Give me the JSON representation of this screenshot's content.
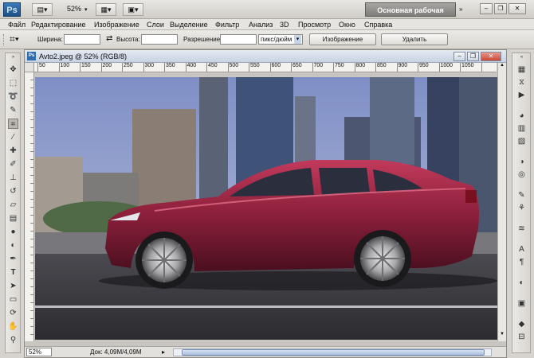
{
  "app": {
    "logo": "Ps",
    "zoom_display": "52%",
    "workspace_button": "Основная рабочая среда"
  },
  "menu": [
    "Файл",
    "Редактирование",
    "Изображение",
    "Слои",
    "Выделение",
    "Фильтр",
    "Анализ",
    "3D",
    "Просмотр",
    "Окно",
    "Справка"
  ],
  "options": {
    "width_label": "Ширина:",
    "height_label": "Высота:",
    "resolution_label": "Разрешение:",
    "unit_select": "пикс/дюйм",
    "image_button": "Изображение",
    "delete_button": "Удалить",
    "swap_icon": "⇄"
  },
  "document": {
    "title": "Avto2.jpeg @ 52% (RGB/8)",
    "icon_label": "Ps",
    "ruler_ticks": [
      "50",
      "100",
      "150",
      "200",
      "250",
      "300",
      "350",
      "400",
      "450",
      "500",
      "550",
      "600",
      "650",
      "700",
      "750",
      "800",
      "850",
      "900",
      "950",
      "1000",
      "1050"
    ]
  },
  "status": {
    "zoom": "52%",
    "doc_info": "Док: 4,09M/4,09M"
  },
  "colors": {
    "car_body": "#8a1f3a",
    "sky": "#9aa7cf",
    "road": "#3d3c40"
  }
}
